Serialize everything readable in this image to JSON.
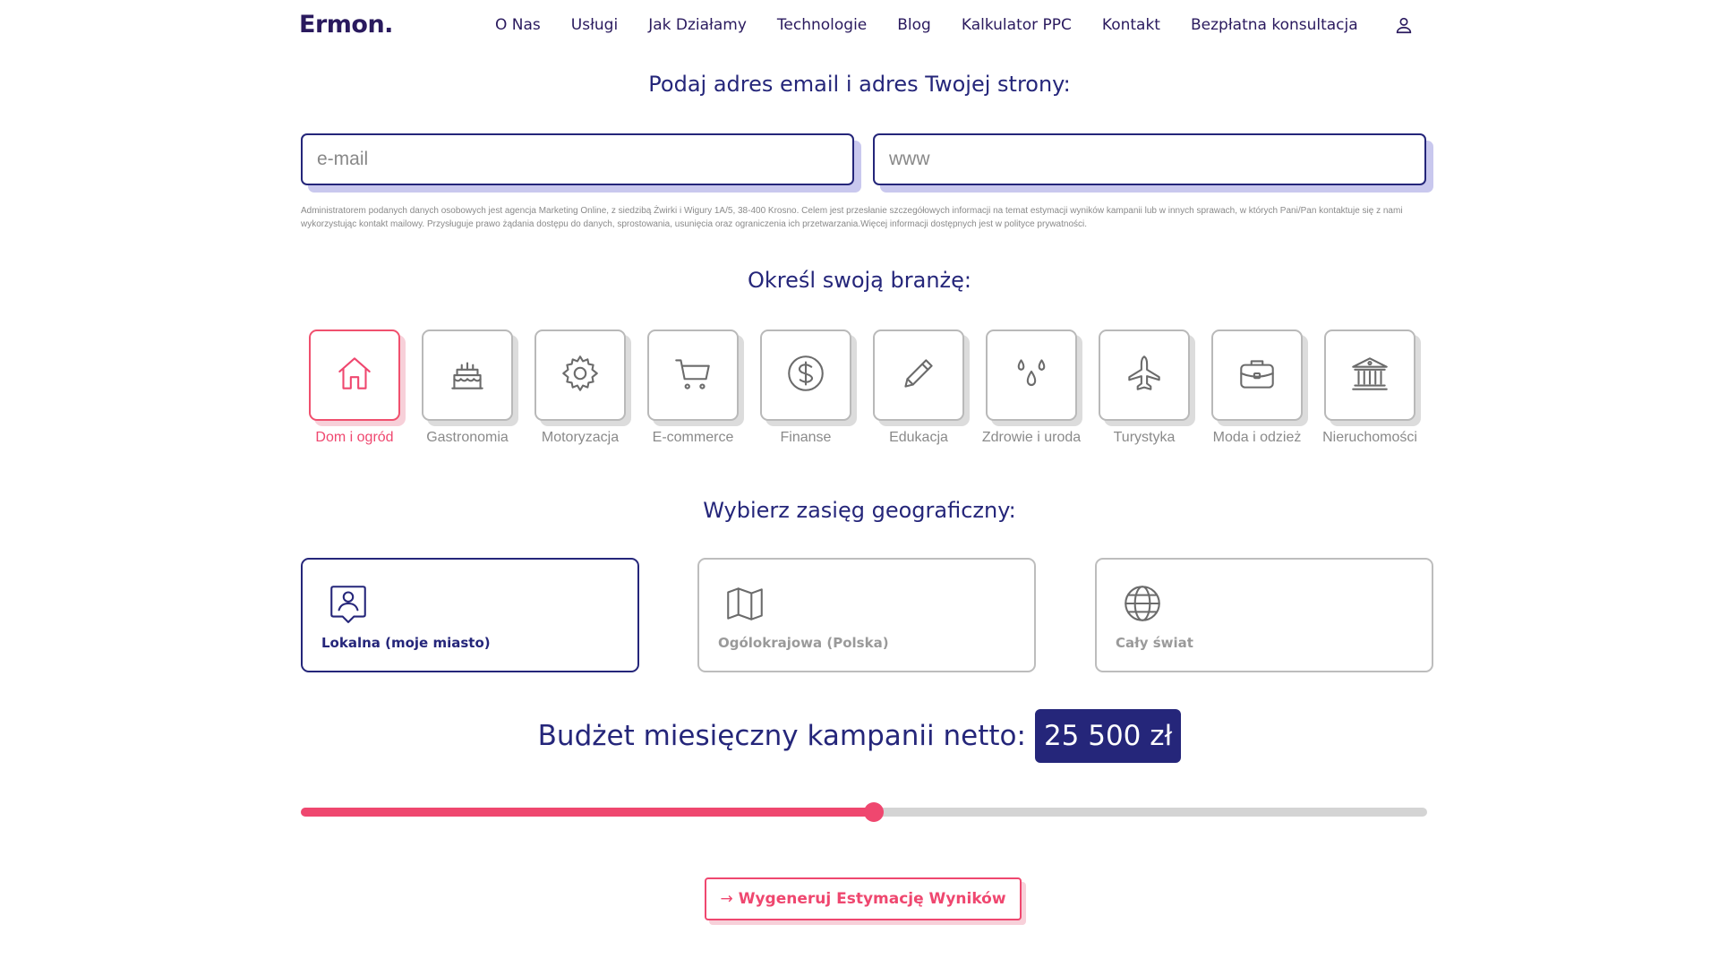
{
  "header": {
    "logo": "Ermon.",
    "nav": [
      "O Nas",
      "Usługi",
      "Jak Działamy",
      "Technologie",
      "Blog",
      "Kalkulator PPC",
      "Kontakt",
      "Bezpłatna konsultacja"
    ]
  },
  "contact": {
    "title": "Podaj adres email i adres Twojej strony:",
    "email_placeholder": "e-mail",
    "www_placeholder": "www",
    "legal": "Administratorem podanych danych osobowych jest agencja Marketing Online, z siedzibą Żwirki i Wigury 1A/5, 38-400 Krosno. Celem jest przesłanie szczegółowych informacji na temat estymacji wyników kampanii lub w innych sprawach, w których Pani/Pan kontaktuje się z nami wykorzystując kontakt mailowy. Przysługuje prawo żądania dostępu do danych, sprostowania, usunięcia oraz ograniczenia ich przetwarzania.Więcej informacji dostępnych jest w polityce prywatności."
  },
  "industry": {
    "title": "Określ swoją branżę:",
    "items": [
      {
        "label": "Dom i ogród",
        "icon": "house-icon",
        "selected": true
      },
      {
        "label": "Gastronomia",
        "icon": "cake-icon",
        "selected": false
      },
      {
        "label": "Motoryzacja",
        "icon": "gear-icon",
        "selected": false
      },
      {
        "label": "E-commerce",
        "icon": "cart-icon",
        "selected": false
      },
      {
        "label": "Finanse",
        "icon": "dollar-icon",
        "selected": false
      },
      {
        "label": "Edukacja",
        "icon": "pencil-icon",
        "selected": false
      },
      {
        "label": "Zdrowie i uroda",
        "icon": "drops-icon",
        "selected": false
      },
      {
        "label": "Turystyka",
        "icon": "plane-icon",
        "selected": false
      },
      {
        "label": "Moda i odzież",
        "icon": "briefcase-icon",
        "selected": false
      },
      {
        "label": "Nieruchomości",
        "icon": "bank-icon",
        "selected": false
      }
    ]
  },
  "geo": {
    "title": "Wybierz zasięg geograficzny:",
    "options": [
      {
        "label": "Lokalna (moje miasto)",
        "icon": "person-pin-icon",
        "selected": true
      },
      {
        "label": "Ogólokrajowa (Polska)",
        "icon": "map-icon",
        "selected": false
      },
      {
        "label": "Cały świat",
        "icon": "globe-icon",
        "selected": false
      }
    ]
  },
  "budget": {
    "label": "Budżet miesięczny kampanii netto:",
    "value": "25 500 zł",
    "slider_fraction": 0.509
  },
  "cta": {
    "arrow": "→",
    "label": "Wygeneruj Estymację Wyników"
  },
  "colors": {
    "navy": "#25267a",
    "accent": "#ef476f",
    "gray": "#8a8a8a"
  }
}
